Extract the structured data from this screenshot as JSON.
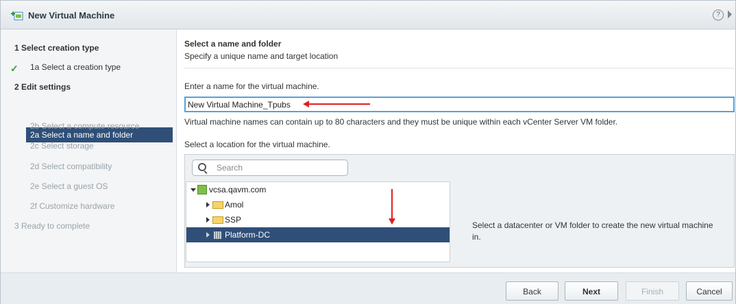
{
  "window": {
    "title": "New Virtual Machine"
  },
  "steps": [
    {
      "label": "1  Select creation type"
    },
    {
      "label": "1a  Select a creation type"
    },
    {
      "label": "2  Edit settings"
    },
    {
      "label": "2a  Select a name and folder"
    },
    {
      "label": "2b  Select a compute resource"
    },
    {
      "label": "2c  Select storage"
    },
    {
      "label": "2d  Select compatibility"
    },
    {
      "label": "2e  Select a guest OS"
    },
    {
      "label": "2f  Customize hardware"
    },
    {
      "label": "3  Ready to complete"
    }
  ],
  "main": {
    "title": "Select a name and folder",
    "subtitle": "Specify a unique name and target location",
    "name_label": "Enter a name for the virtual machine.",
    "name_value": "New Virtual Machine_Tpubs",
    "name_hint": "Virtual machine names can contain up to 80 characters and they must be unique within each vCenter Server VM folder.",
    "location_label": "Select a location for the virtual machine.",
    "search_placeholder": "Search",
    "tree": {
      "root": "vcsa.qavm.com",
      "children": [
        "Amol",
        "SSP",
        "Platform-DC"
      ]
    },
    "info_text": "Select a datacenter or VM folder to create the new virtual machine in."
  },
  "footer": {
    "back": "Back",
    "next": "Next",
    "finish": "Finish",
    "cancel": "Cancel"
  },
  "colors": {
    "selected_bg": "#2f4f78",
    "annotation_arrow": "#e0201f",
    "input_focus": "#5aa0d6"
  }
}
